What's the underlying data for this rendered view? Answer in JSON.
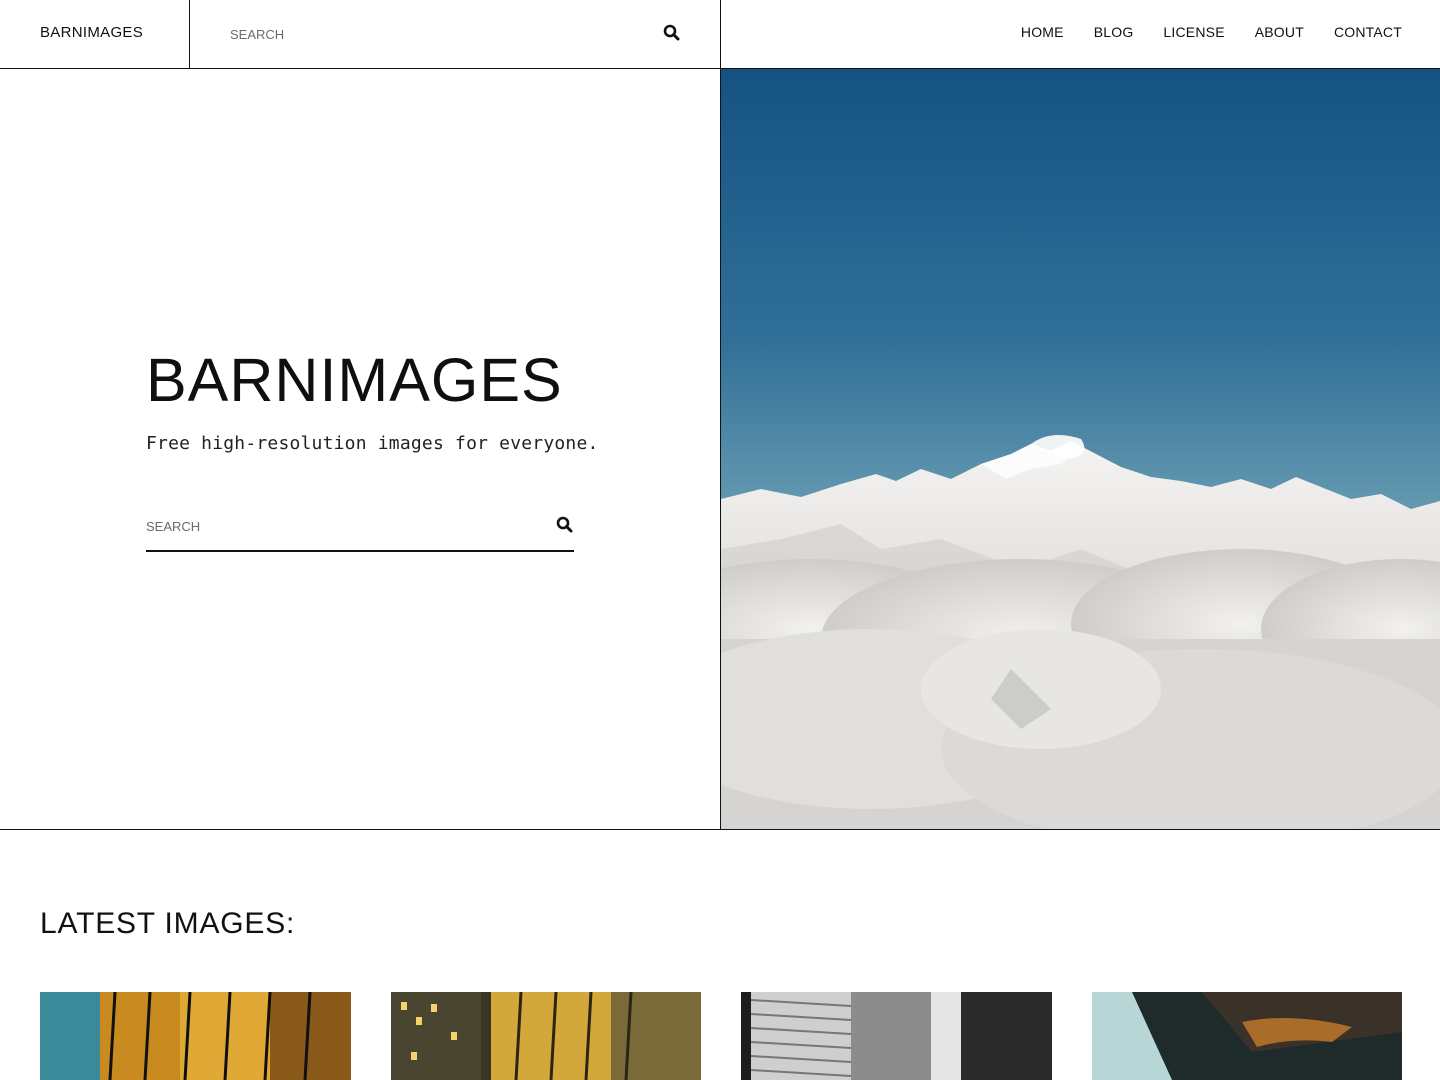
{
  "header": {
    "logo": "BARNIMAGES",
    "search_placeholder": "SEARCH",
    "search_icon": "search-icon",
    "nav": [
      "HOME",
      "BLOG",
      "LICENSE",
      "ABOUT",
      "CONTACT"
    ]
  },
  "hero": {
    "title": "BARNIMAGES",
    "subtitle": "Free high-resolution images for everyone.",
    "search_placeholder": "SEARCH",
    "search_icon": "search-icon",
    "image": "snowy-mountains-above-clouds-photo"
  },
  "latest": {
    "title": "LATEST IMAGES:",
    "thumbnails": [
      "golden-glass-building-photo",
      "yellow-lit-office-towers-photo",
      "black-white-skyscraper-photo",
      "curved-building-underside-photo"
    ]
  },
  "colors": {
    "text": "#111111",
    "border": "#111111",
    "sky_top": "#145283",
    "sky_bottom": "#7fa9b8"
  }
}
